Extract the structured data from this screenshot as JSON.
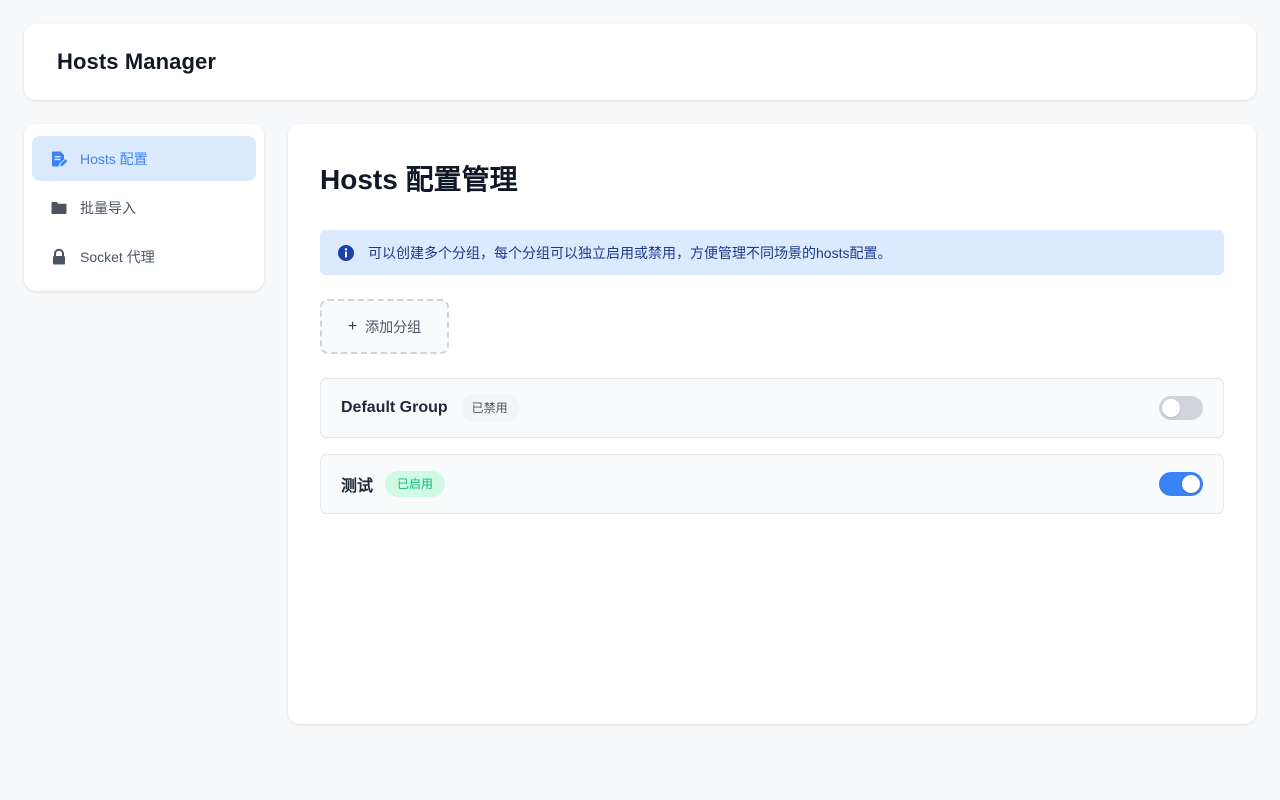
{
  "app": {
    "title": "Hosts Manager"
  },
  "sidebar": {
    "items": [
      {
        "label": "Hosts 配置",
        "icon": "file-edit-icon",
        "active": true
      },
      {
        "label": "批量导入",
        "icon": "folder-icon",
        "active": false
      },
      {
        "label": "Socket 代理",
        "icon": "lock-icon",
        "active": false
      }
    ]
  },
  "main": {
    "title": "Hosts 配置管理",
    "info": {
      "icon": "info-icon",
      "text": "可以创建多个分组，每个分组可以独立启用或禁用，方便管理不同场景的hosts配置。"
    },
    "add_group": {
      "icon": "plus-icon",
      "label": "添加分组"
    },
    "groups": [
      {
        "name": "Default Group",
        "status": "已禁用",
        "enabled": false
      },
      {
        "name": "测试",
        "status": "已启用",
        "enabled": true
      }
    ]
  },
  "colors": {
    "accent": "#3b82f6",
    "active_bg": "#dbeafe",
    "success": "#10b981",
    "success_bg": "#d1fae5",
    "toggle_off": "#d1d5db"
  }
}
